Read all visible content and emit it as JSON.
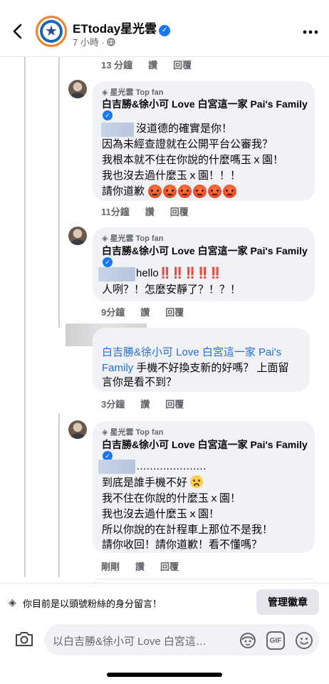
{
  "header": {
    "page_name": "ETtoday星光雲",
    "verified_mark": "✓",
    "timestamp": "7 小時",
    "separator": "·",
    "audience_icon": "globe-icon",
    "back_icon": "chevron-left-icon",
    "more_icon": "ellipsis-icon"
  },
  "top_actions": {
    "time": "13 分鐘",
    "like": "讚",
    "reply": "回覆"
  },
  "comments": [
    {
      "top_fan_label": "星光雲 Top fan",
      "author": "白吉勝&徐小可 Love 白宮這一家 Pai's Family",
      "lines": [
        "沒道德的確實是你！",
        "因為未經查證就在公開平台公審我？",
        "我根本就不住在你說的什麼嗎玉ｘ園！",
        "我也沒去過什麼玉ｘ園！！！",
        "請你道歉"
      ],
      "emoji_count": 6,
      "time": "11分鐘",
      "like": "讚",
      "reply": "回覆"
    },
    {
      "top_fan_label": "星光雲 Top fan",
      "author": "白吉勝&徐小可 Love 白宮這一家 Pai's Family",
      "lines": [
        "hello",
        "人咧？！怎麼安靜了？！？！"
      ],
      "bangs": "‼️‼️‼️‼️‼️",
      "time": "9分鐘",
      "like": "讚",
      "reply": "回覆"
    },
    {
      "mention_line1": "白吉勝&徐小可 Love 白宮這一家 Pai's",
      "mention_line2": "Family",
      "text_line2_rest": "手機不好換支新的好嗎？ 上面留",
      "text_line3": "言你是看不到？",
      "time": "3分鐘",
      "like": "讚",
      "reply": "回覆"
    },
    {
      "top_fan_label": "星光雲 Top fan",
      "author": "白吉勝&徐小可 Love 白宮這一家 Pai's Family",
      "lines": [
        "…………………",
        "到底是誰手機不好",
        "我不住在你說的什麼玉ｘ園！",
        "我也沒去過什麼玉ｘ園！",
        "所以你說的在計程車上那位不是我！",
        "請你收回！請你道歉！看不懂嗎？"
      ],
      "time": "剛剛",
      "like": "讚",
      "reply": "回覆"
    }
  ],
  "fan_notice": {
    "text": "你目前是以頭號粉絲的身分留言！",
    "button": "管理徽章"
  },
  "composer": {
    "placeholder": "以白吉勝&徐小可 Love 白宮這…",
    "gif_label": "GIF"
  },
  "colors": {
    "link": "#216fdb",
    "verified": "#1877f2",
    "bubble": "#f0f2f5",
    "accent_orange": "#f58220"
  }
}
